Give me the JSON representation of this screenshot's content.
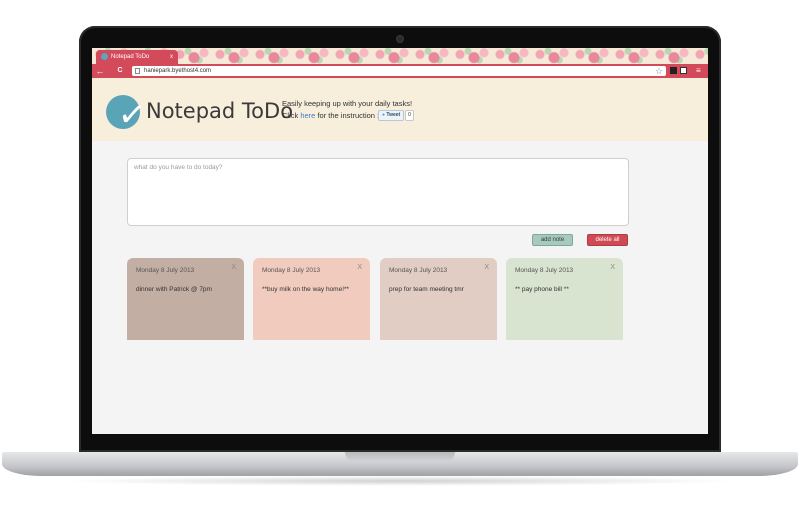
{
  "browser": {
    "tab_title": "Notepad ToDo",
    "tab_close": "x",
    "url": "haniepark.byethost4.com",
    "back_icon": "←",
    "reload_icon": "C",
    "star_icon": "☆",
    "menu_icon": "≡",
    "colors": {
      "chrome": "#d34a5b"
    }
  },
  "app": {
    "title": "Notepad ToDo",
    "tagline_line1": "Easily keeping up with your daily tasks!",
    "tagline_prefix": "Click ",
    "tagline_link": "here",
    "tagline_suffix": " for the instruction :)",
    "tweet_label": "Tweet",
    "tweet_count": "0",
    "colors": {
      "header_bg": "#f7eedb",
      "logo": "#5aa4b8"
    }
  },
  "input": {
    "placeholder": "what do you have to do today?",
    "value": ""
  },
  "actions": {
    "add_label": "add note",
    "delete_label": "delete all"
  },
  "notes": [
    {
      "date": "Monday 8 July 2013",
      "text": "dinner with Patrick @ 7pm",
      "close": "X",
      "color": "#c3aea4"
    },
    {
      "date": "Monday 8 July 2013",
      "text": "**buy milk on the way home!**",
      "close": "X",
      "color": "#f1cbbd"
    },
    {
      "date": "Monday 8 July 2013",
      "text": "prep for team meeting tmr",
      "close": "X",
      "color": "#e1cdc4"
    },
    {
      "date": "Monday 8 July 2013",
      "text": "** pay phone bill **",
      "close": "X",
      "color": "#d8e3d0"
    }
  ]
}
